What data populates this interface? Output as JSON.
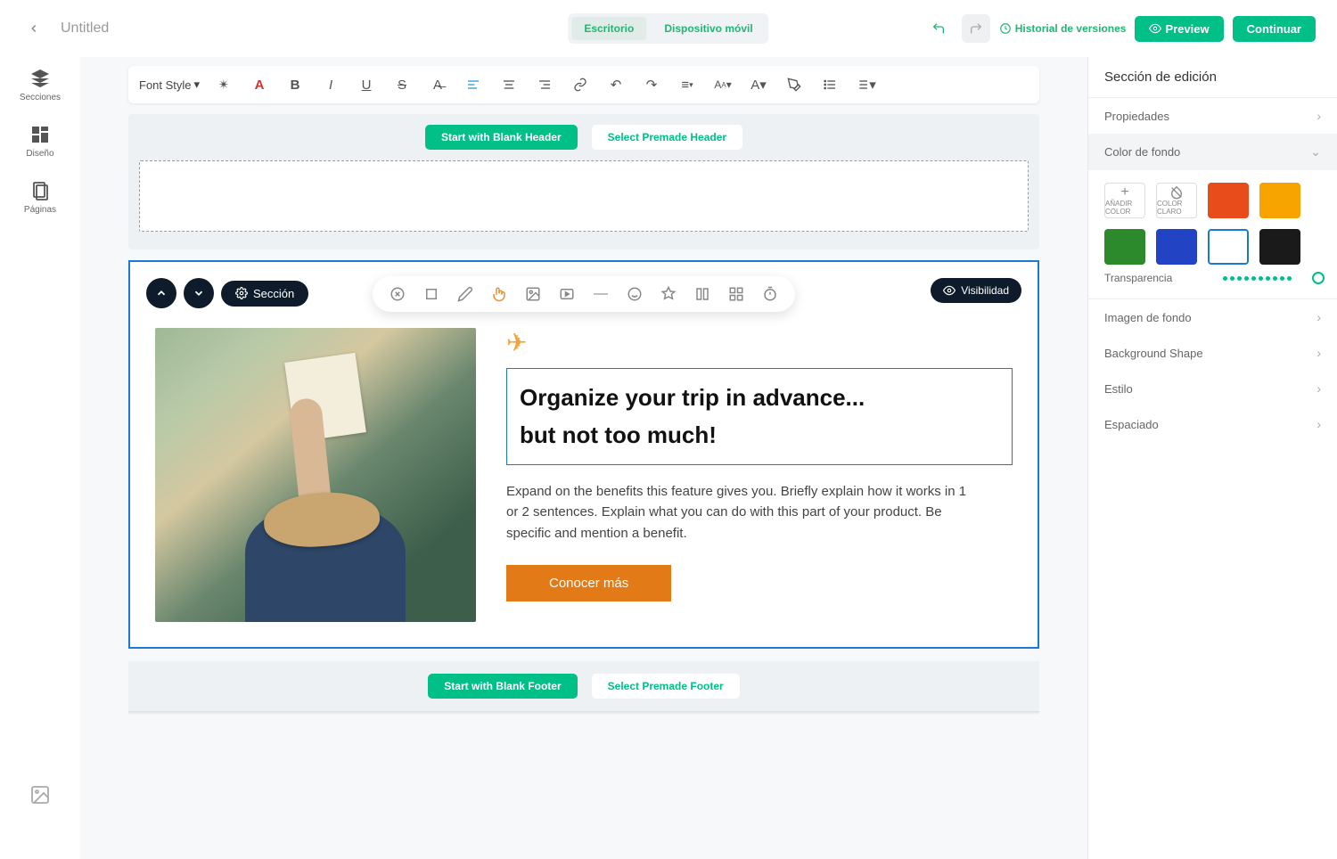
{
  "topbar": {
    "title": "Untitled",
    "device_desktop": "Escritorio",
    "device_mobile": "Dispositivo móvil",
    "history": "Historial de versiones",
    "preview": "Preview",
    "continue": "Continuar"
  },
  "rail": {
    "sections": "Secciones",
    "design": "Diseño",
    "pages": "Páginas"
  },
  "toolbar": {
    "font_style": "Font Style"
  },
  "header_zone": {
    "start_blank": "Start with Blank Header",
    "select_premade": "Select Premade Header"
  },
  "section": {
    "label": "Sección",
    "visibility": "Visibilidad",
    "heading_line1": "Organize your trip in advance...",
    "heading_line2": "but not too much!",
    "body": "Expand on the benefits this feature gives you. Briefly explain how it works in 1 or 2 sentences. Explain what you can do with this part of your product. Be specific and mention a benefit.",
    "cta": "Conocer más"
  },
  "footer_zone": {
    "start_blank": "Start with Blank Footer",
    "select_premade": "Select Premade Footer"
  },
  "props": {
    "title": "Sección de edición",
    "properties": "Propiedades",
    "bg_color": "Color de fondo",
    "add_color": "AÑADIR COLOR",
    "clear_color": "COLOR CLARO",
    "transparency": "Transparencia",
    "bg_image": "Imagen de fondo",
    "bg_shape": "Background Shape",
    "style": "Estilo",
    "spacing": "Espaciado",
    "colors": [
      "#e84c1a",
      "#f7a400",
      "#2c8a2c",
      "#2244c4",
      "#ffffff",
      "#1a1a1a"
    ]
  }
}
